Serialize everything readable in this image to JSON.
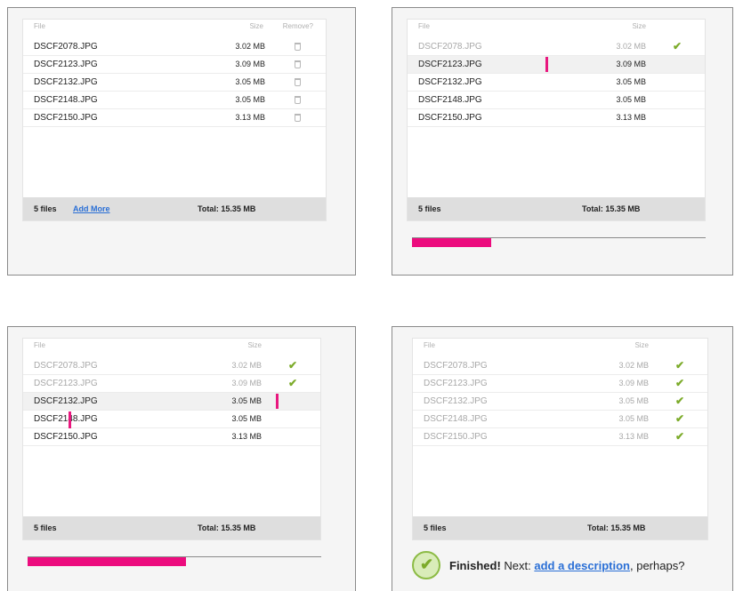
{
  "columns": {
    "file": "File",
    "size": "Size",
    "remove": "Remove?"
  },
  "files": [
    {
      "name": "DSCF2078.JPG",
      "size": "3.02 MB"
    },
    {
      "name": "DSCF2123.JPG",
      "size": "3.09 MB"
    },
    {
      "name": "DSCF2132.JPG",
      "size": "3.05 MB"
    },
    {
      "name": "DSCF2148.JPG",
      "size": "3.05 MB"
    },
    {
      "name": "DSCF2150.JPG",
      "size": "3.13 MB"
    }
  ],
  "footer": {
    "count": "5 files",
    "add_more": "Add More",
    "total": "Total: 15.35 MB"
  },
  "progress": {
    "panel2": 0.27,
    "panel3": 0.54
  },
  "finished": {
    "bold": "Finished!",
    "next": " Next: ",
    "link": "add a description",
    "after": ", perhaps?"
  },
  "icons": {
    "remove": "trash-icon",
    "done": "checkmark-icon",
    "finished": "checkmark-circle-icon"
  },
  "colors": {
    "accent": "#ec0c7e",
    "link": "#2a6fd6",
    "check": "#7cab2a"
  }
}
